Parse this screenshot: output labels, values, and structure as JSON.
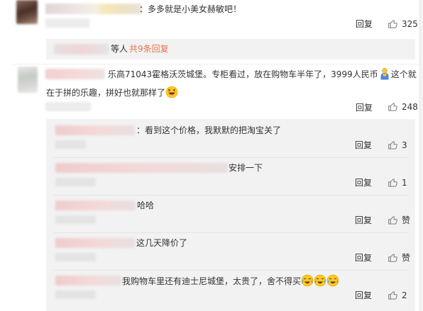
{
  "colors": {
    "text": "#333333",
    "link_orange": "#eb7350",
    "reply_box_bg": "#f2f2f2",
    "icon_gray": "#7d7d7d"
  },
  "icons": {
    "like": "thumbs-up-icon",
    "emoji_person": "person-emoji-icon",
    "emoji_laugh": "laughing-emoji-icon",
    "emoji_tears": "tears-of-joy-emoji-icon"
  },
  "comments": [
    {
      "text": "：多多就是小美女赫敏吧！",
      "reply_label": "回复",
      "likes": "325",
      "reply_summary": {
        "suffix": "等人",
        "link": "共9条回复"
      }
    },
    {
      "text_line1": "乐高71043霍格沃茨城堡。专柜看过，放在购物车半年了，3999人民币",
      "text_line1_tail": "这个就",
      "text_line2": "在于拼的乐趣，拼好也就那样了",
      "reply_label": "回复",
      "likes": "248",
      "replies": [
        {
          "text": "：看到这个价格，我默默的把淘宝关了",
          "reply_label": "回复",
          "likes": "3"
        },
        {
          "text": "安排一下",
          "reply_label": "回复",
          "likes": "1"
        },
        {
          "text": "哈哈",
          "reply_label": "回复",
          "likes": "赞"
        },
        {
          "text": "这几天降价了",
          "reply_label": "回复",
          "likes": "赞"
        },
        {
          "text": "我购物车里还有迪士尼城堡，太贵了，舍不得买",
          "reply_label": "回复",
          "likes": "2"
        }
      ]
    }
  ]
}
